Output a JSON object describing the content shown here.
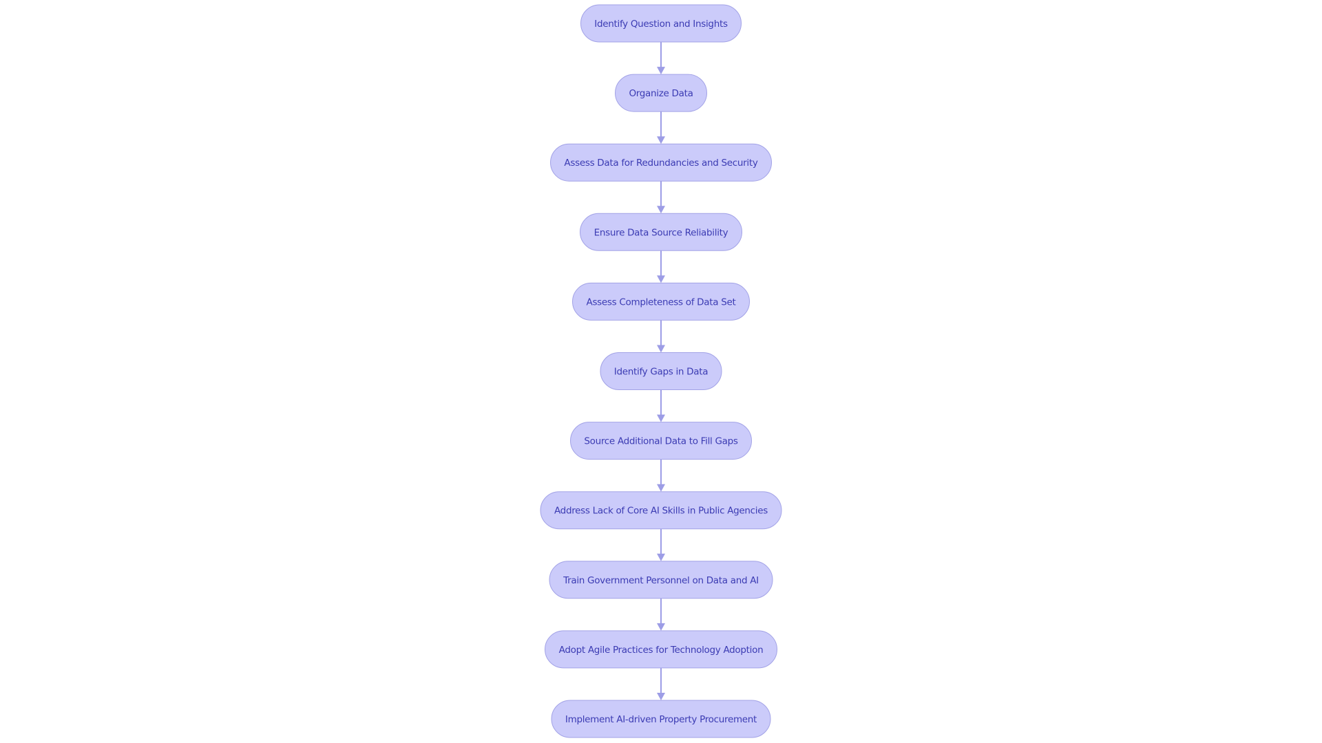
{
  "diagram": {
    "type": "flowchart",
    "direction": "top-to-bottom",
    "colors": {
      "node_fill": "#cbcbfa",
      "node_stroke": "#a2a2e6",
      "node_text": "#3b3bb3",
      "edge": "#9d9de6"
    },
    "nodes": [
      {
        "id": "n1",
        "label": "Identify Question and Insights"
      },
      {
        "id": "n2",
        "label": "Organize Data"
      },
      {
        "id": "n3",
        "label": "Assess Data for Redundancies and Security"
      },
      {
        "id": "n4",
        "label": "Ensure Data Source Reliability"
      },
      {
        "id": "n5",
        "label": "Assess Completeness of Data Set"
      },
      {
        "id": "n6",
        "label": "Identify Gaps in Data"
      },
      {
        "id": "n7",
        "label": "Source Additional Data to Fill Gaps"
      },
      {
        "id": "n8",
        "label": "Address Lack of Core AI Skills in Public Agencies"
      },
      {
        "id": "n9",
        "label": "Train Government Personnel on Data and AI"
      },
      {
        "id": "n10",
        "label": "Adopt Agile Practices for Technology Adoption"
      },
      {
        "id": "n11",
        "label": "Implement AI-driven Property Procurement"
      }
    ],
    "edges": [
      {
        "from": "n1",
        "to": "n2"
      },
      {
        "from": "n2",
        "to": "n3"
      },
      {
        "from": "n3",
        "to": "n4"
      },
      {
        "from": "n4",
        "to": "n5"
      },
      {
        "from": "n5",
        "to": "n6"
      },
      {
        "from": "n6",
        "to": "n7"
      },
      {
        "from": "n7",
        "to": "n8"
      },
      {
        "from": "n8",
        "to": "n9"
      },
      {
        "from": "n9",
        "to": "n10"
      },
      {
        "from": "n10",
        "to": "n11"
      }
    ]
  }
}
